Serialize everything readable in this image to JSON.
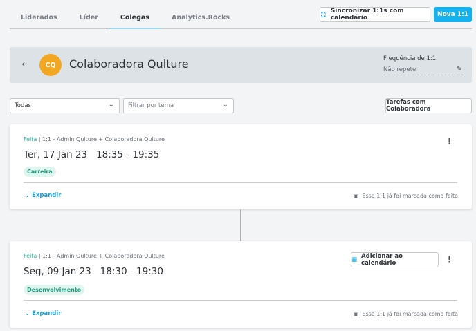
{
  "tabs": [
    {
      "label": "Liderados"
    },
    {
      "label": "Líder"
    },
    {
      "label": "Colegas"
    },
    {
      "label": "Analytics.Rocks"
    }
  ],
  "actions": {
    "sync_label": "Sincronizar 1:1s com calendário",
    "new_label": "Nova 1:1"
  },
  "header": {
    "initials": "CQ",
    "name": "Colaboradora Qulture",
    "frequency_label": "Frequência de 1:1",
    "frequency_value": "Não repete"
  },
  "filters": {
    "status_value": "Todas",
    "theme_placeholder": "Filtrar por tema",
    "tasks_label": "Tarefas com Colaboradora"
  },
  "meetings": [
    {
      "status": "Feita",
      "participants": "1:1 - Admin Qulture + Colaboradora Qulture",
      "date": "Ter, 17 Jan 23",
      "start": "18:35",
      "end": "19:35",
      "tag": "Carreira",
      "expand_label": "Expandir",
      "done_note": "Essa 1:1 já foi marcada como feita"
    },
    {
      "status": "Feita",
      "participants": "1:1 - Admin Qulture + Colaboradora Qulture",
      "date": "Seg, 09 Jan 23",
      "start": "18:30",
      "end": "19:30",
      "tag": "Desenvolvimento",
      "expand_label": "Expandir",
      "done_note": "Essa 1:1 já foi marcada como feita",
      "calendar_label": "Adicionar ao calendário"
    }
  ]
}
